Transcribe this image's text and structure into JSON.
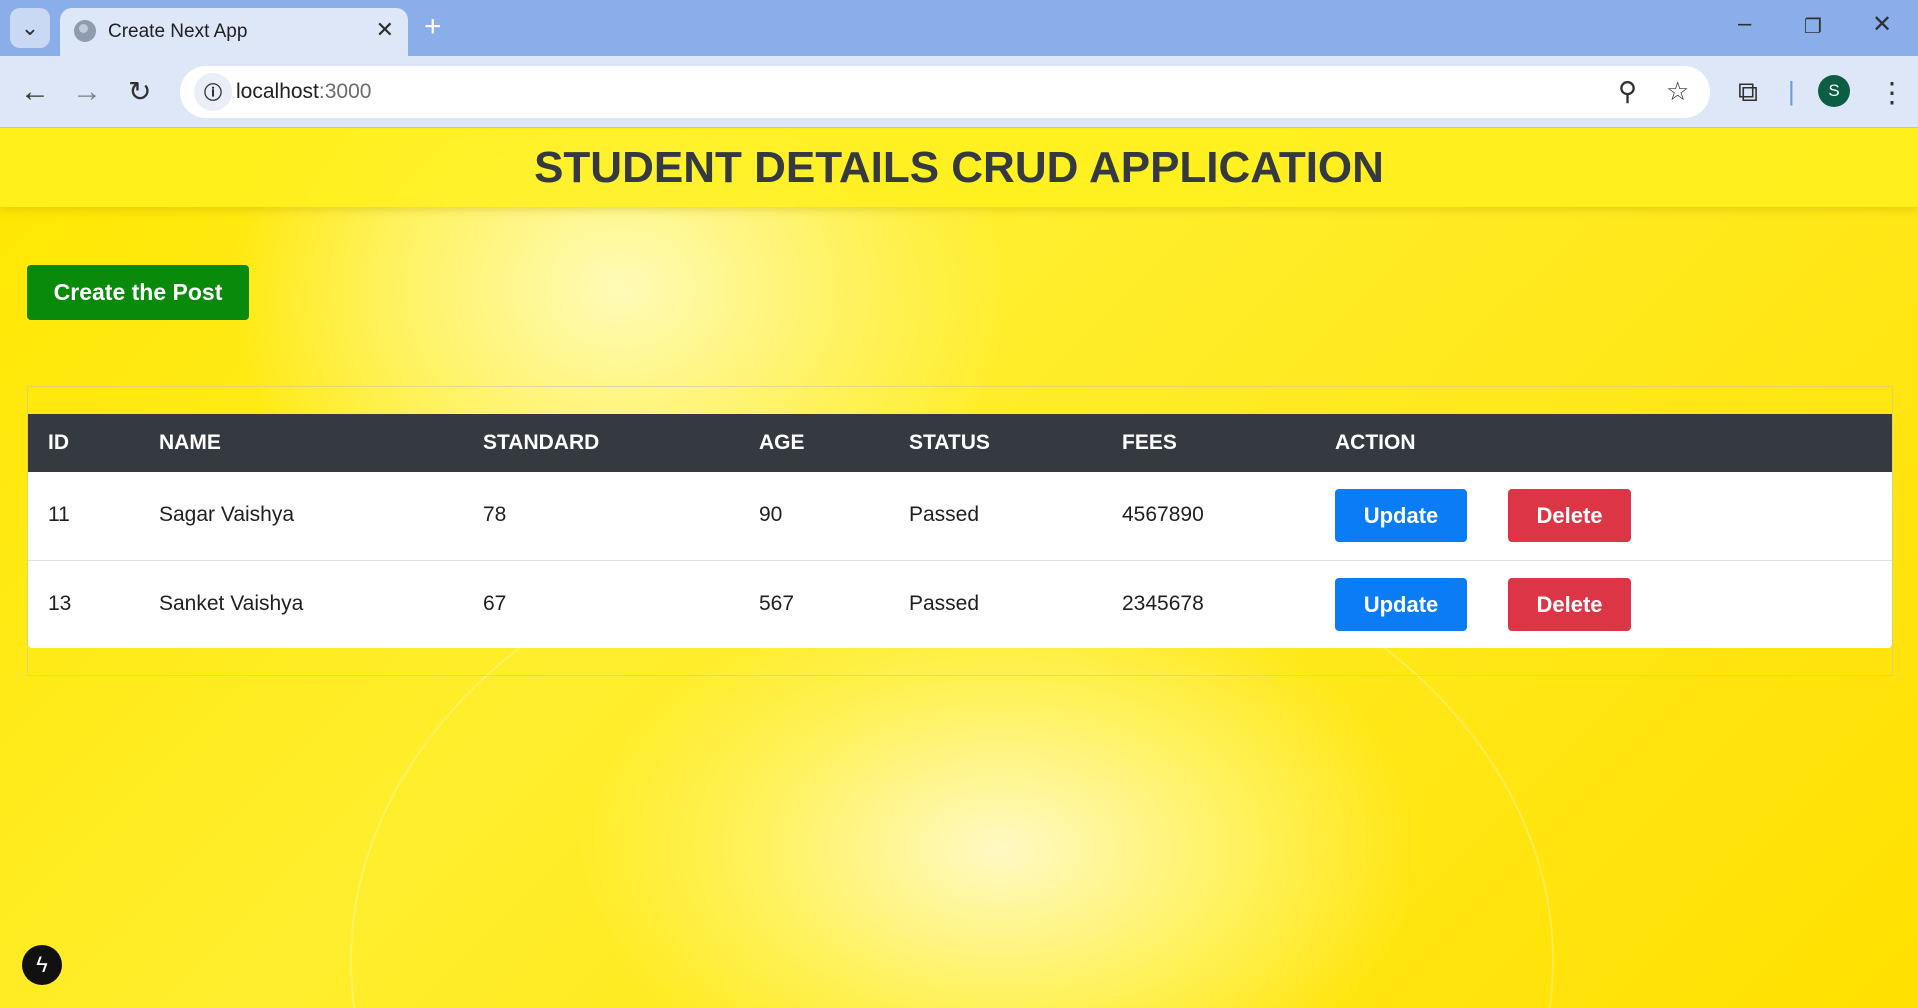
{
  "browser": {
    "tab_title": "Create Next App",
    "tab_close": "✕",
    "new_tab": "+",
    "tab_list": "⌄",
    "url_host": "localhost",
    "url_port": ":3000",
    "avatar_letter": "S",
    "window_minimize": "–",
    "window_restore": "❐",
    "window_close": "✕",
    "icons": [
      "back-icon",
      "forward-icon",
      "reload-icon",
      "site-info-icon",
      "zoom-icon",
      "star-icon",
      "extensions-icon",
      "menu-icon"
    ]
  },
  "page": {
    "title": "STUDENT DETAILS CRUD APPLICATION",
    "create_button": "Create the Post",
    "accent_colors": {
      "create": "#0a8a0a",
      "update": "#0a7cf5",
      "delete": "#dc3545",
      "header": "#343a40"
    }
  },
  "table": {
    "headers": [
      "ID",
      "NAME",
      "STANDARD",
      "AGE",
      "STATUS",
      "FEES",
      "ACTION"
    ],
    "rows": [
      {
        "id": "11",
        "name": "Sagar Vaishya",
        "standard": "78",
        "age": "90",
        "status": "Passed",
        "fees": "4567890",
        "update": "Update",
        "delete": "Delete"
      },
      {
        "id": "13",
        "name": "Sanket Vaishya",
        "standard": "67",
        "age": "567",
        "status": "Passed",
        "fees": "2345678",
        "update": "Update",
        "delete": "Delete"
      }
    ]
  },
  "dev_badge": "ϟ"
}
